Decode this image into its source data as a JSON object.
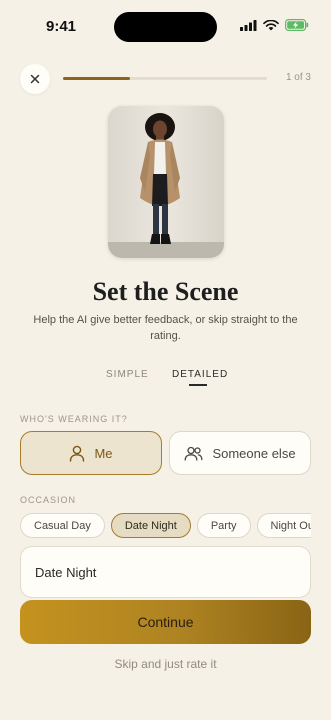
{
  "status_bar": {
    "time": "9:41"
  },
  "nav": {
    "step_indicator": "1 of 3",
    "progress": 0.33
  },
  "header": {
    "title": "Set the Scene",
    "subtitle": "Help the AI give better feedback, or skip straight to the rating."
  },
  "mode_tabs": {
    "simple": "SIMPLE",
    "detailed": "DETAILED",
    "selected": "detailed"
  },
  "wearer": {
    "section_label": "WHO'S WEARING IT?",
    "options": [
      {
        "label": "Me",
        "icon": "person-icon",
        "selected": true
      },
      {
        "label": "Someone else",
        "icon": "people-icon",
        "selected": false
      }
    ]
  },
  "occasion": {
    "section_label": "OCCASION",
    "chips": [
      "Casual Day",
      "Date Night",
      "Party",
      "Night Out"
    ],
    "selected_chip": "Date Night",
    "field_value": "Date Night"
  },
  "actions": {
    "continue_label": "Continue",
    "skip_label": "Skip and just rate it"
  },
  "colors": {
    "accent": "#a57c2c",
    "background": "#f5f1e6",
    "button_gradient_start": "#c4921e",
    "button_gradient_end": "#8a6415"
  }
}
